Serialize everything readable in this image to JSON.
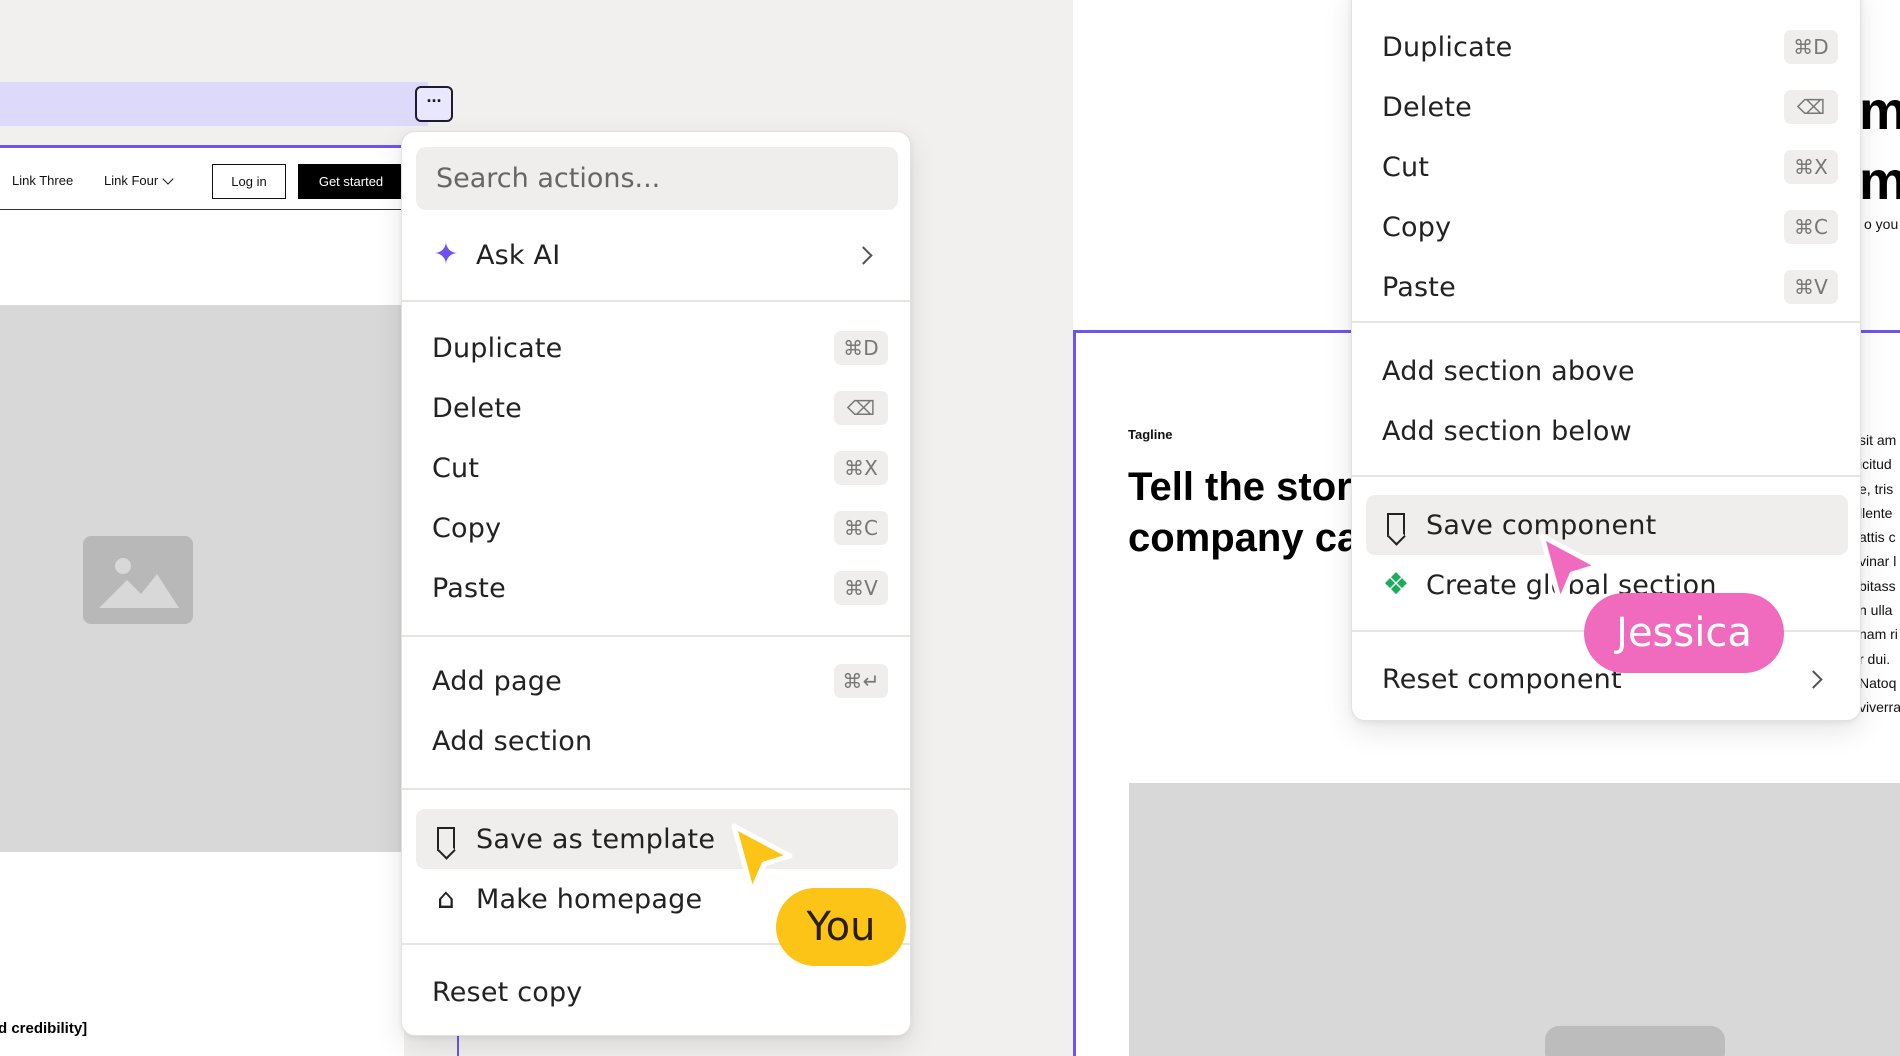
{
  "left_panel": {
    "selection_more_label": "···",
    "site_nav": {
      "links": [
        "Link Three",
        "Link Four"
      ],
      "login_label": "Log in",
      "cta_label": "Get started"
    },
    "footer_text": "d credibility]"
  },
  "menu_left": {
    "search_placeholder": "Search actions...",
    "ask_ai_label": "Ask AI",
    "items": [
      {
        "label": "Duplicate",
        "shortcut": "⌘D"
      },
      {
        "label": "Delete",
        "shortcut": "⌫"
      },
      {
        "label": "Cut",
        "shortcut": "⌘X"
      },
      {
        "label": "Copy",
        "shortcut": "⌘C"
      },
      {
        "label": "Paste",
        "shortcut": "⌘V"
      }
    ],
    "add_page_label": "Add page",
    "add_page_shortcut": "⌘↵",
    "add_section_label": "Add section",
    "save_template_label": "Save as template",
    "make_homepage_label": "Make homepage",
    "reset_copy_label": "Reset copy"
  },
  "menu_right": {
    "items": [
      {
        "label": "Duplicate",
        "shortcut": "⌘D"
      },
      {
        "label": "Delete",
        "shortcut": "⌫"
      },
      {
        "label": "Cut",
        "shortcut": "⌘X"
      },
      {
        "label": "Copy",
        "shortcut": "⌘C"
      },
      {
        "label": "Paste",
        "shortcut": "⌘V"
      }
    ],
    "add_above_label": "Add section above",
    "add_below_label": "Add section below",
    "save_component_label": "Save component",
    "create_global_label": "Create global section",
    "reset_component_label": "Reset component"
  },
  "collaborators": {
    "you": {
      "label": "You",
      "color": "#fbc417"
    },
    "jessica": {
      "label": "Jessica",
      "color": "#f06bbd"
    }
  },
  "right_panel": {
    "tagline": "Tagline",
    "heading_lines": [
      "Tell the stor",
      "company ca"
    ],
    "big_heading_lines": [
      "mp",
      "me"
    ],
    "small_text": "o you",
    "side_column": [
      "sit am",
      "icitud",
      "e, tris",
      "llente",
      "attis c",
      "vinar l",
      "bitass",
      "n ulla",
      "nam ri",
      "r dui.",
      "Natoq",
      "viverra"
    ]
  },
  "colors": {
    "accent": "#6e55f0",
    "selection_bar": "#dcd9fb",
    "ai_sparkle": "#6d4ff2",
    "component_icon": "#1dab5c"
  },
  "icons": [
    "more-icon",
    "sparkle-icon",
    "chevron-right-icon",
    "bookmark-icon",
    "home-icon",
    "component-icon",
    "image-placeholder-icon",
    "chevron-down-icon",
    "cursor-icon"
  ]
}
